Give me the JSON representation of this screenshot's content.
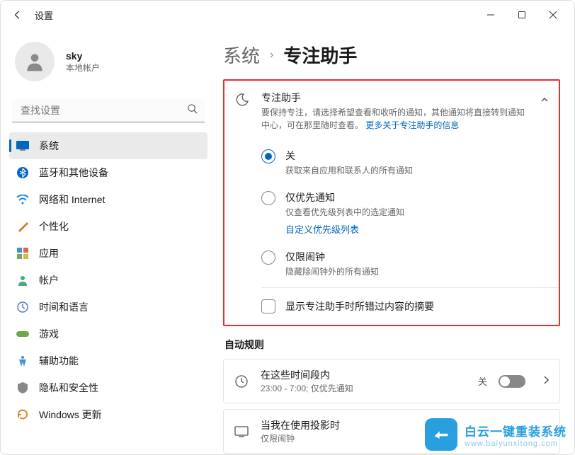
{
  "window": {
    "title": "设置"
  },
  "profile": {
    "name": "sky",
    "subtitle": "本地帐户"
  },
  "search": {
    "placeholder": "查找设置"
  },
  "sidebar": {
    "items": [
      {
        "label": "系统"
      },
      {
        "label": "蓝牙和其他设备"
      },
      {
        "label": "网络和 Internet"
      },
      {
        "label": "个性化"
      },
      {
        "label": "应用"
      },
      {
        "label": "帐户"
      },
      {
        "label": "时间和语言"
      },
      {
        "label": "游戏"
      },
      {
        "label": "辅助功能"
      },
      {
        "label": "隐私和安全性"
      },
      {
        "label": "Windows 更新"
      }
    ]
  },
  "breadcrumb": {
    "parent": "系统",
    "current": "专注助手"
  },
  "focus": {
    "title": "专注助手",
    "description": "要保持专注，请选择希望查看和收听的通知，其他通知将直接转到通知中心，可在那里随时查看。 ",
    "link_text": "更多关于专注助手的信息",
    "options": [
      {
        "label": "关",
        "sub": "获取来自应用和联系人的所有通知"
      },
      {
        "label": "仅优先通知",
        "sub": "仅查看优先级列表中的选定通知",
        "link": "自定义优先级列表"
      },
      {
        "label": "仅限闹钟",
        "sub": "隐藏除闹钟外的所有通知"
      }
    ],
    "checkbox_label": "显示专注助手时所错过内容的摘要"
  },
  "auto_rules": {
    "heading": "自动规则",
    "items": [
      {
        "title": "在这些时间段内",
        "sub": "23:00 - 7:00; 仅优先通知",
        "state": "关"
      },
      {
        "title": "当我在使用投影时",
        "sub": "仅限闹钟"
      }
    ]
  },
  "watermark": {
    "text": "白云一键重装系统",
    "url": "www.baiyunxitong.com"
  }
}
